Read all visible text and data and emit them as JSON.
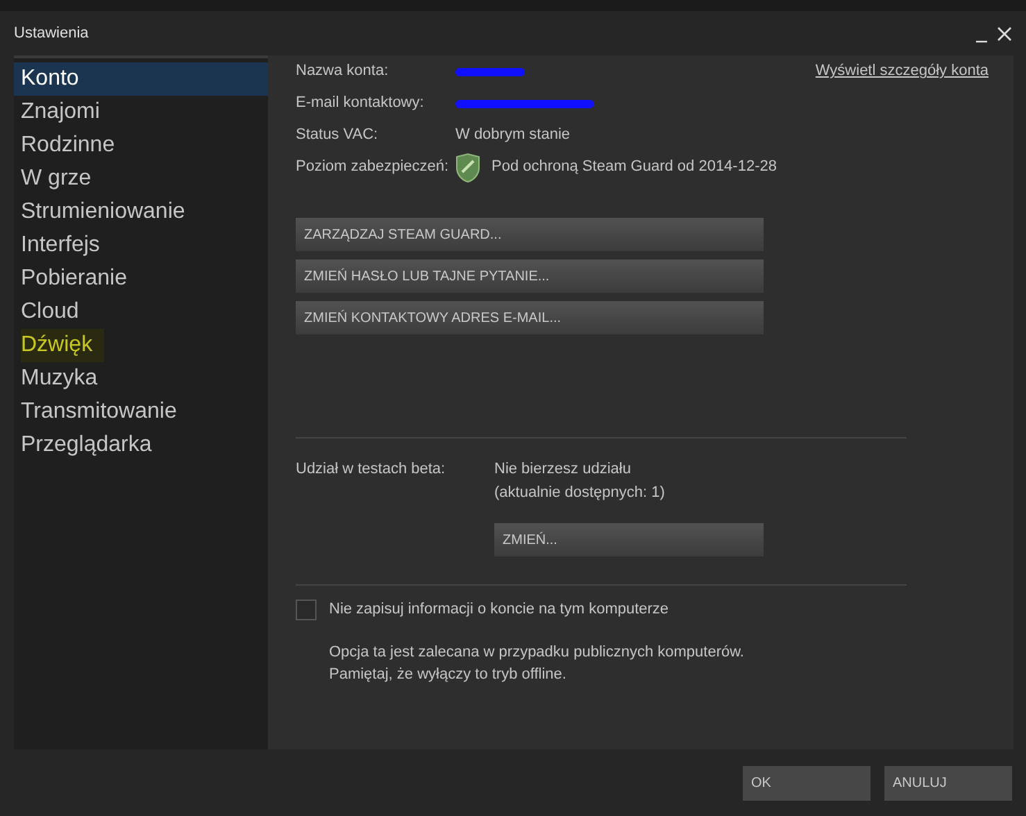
{
  "window": {
    "title": "Ustawienia"
  },
  "sidebar": {
    "items": [
      {
        "label": "Konto",
        "selected": true,
        "highlighted": false
      },
      {
        "label": "Znajomi",
        "selected": false,
        "highlighted": false
      },
      {
        "label": "Rodzinne",
        "selected": false,
        "highlighted": false
      },
      {
        "label": "W grze",
        "selected": false,
        "highlighted": false
      },
      {
        "label": "Strumieniowanie",
        "selected": false,
        "highlighted": false
      },
      {
        "label": "Interfejs",
        "selected": false,
        "highlighted": false
      },
      {
        "label": "Pobieranie",
        "selected": false,
        "highlighted": false
      },
      {
        "label": "Cloud",
        "selected": false,
        "highlighted": false
      },
      {
        "label": "Dźwięk",
        "selected": false,
        "highlighted": true
      },
      {
        "label": "Muzyka",
        "selected": false,
        "highlighted": false
      },
      {
        "label": "Transmitowanie",
        "selected": false,
        "highlighted": false
      },
      {
        "label": "Przeglądarka",
        "selected": false,
        "highlighted": false
      }
    ]
  },
  "account": {
    "details_link": "Wyświetl szczegóły konta",
    "fields": [
      {
        "label": "Nazwa konta:",
        "kind": "redacted"
      },
      {
        "label": "E-mail kontaktowy:",
        "kind": "redacted"
      },
      {
        "label": "Status VAC:",
        "kind": "text",
        "value": "W dobrym stanie"
      },
      {
        "label": "Poziom zabezpieczeń:",
        "kind": "shield",
        "value": "Pod ochroną Steam Guard od 2014-12-28"
      }
    ],
    "buttons": [
      "ZARZĄDZAJ STEAM GUARD...",
      "ZMIEŃ HASŁO LUB TAJNE PYTANIE...",
      "ZMIEŃ KONTAKTOWY ADRES E-MAIL..."
    ]
  },
  "beta": {
    "label": "Udział w testach beta:",
    "status": "Nie bierzesz udziału",
    "available": "(aktualnie dostępnych: 1)",
    "button": "ZMIEŃ..."
  },
  "remember": {
    "label": "Nie zapisuj informacji o koncie na tym komputerze",
    "checked": false,
    "note_lines": [
      "Opcja ta jest zalecana w przypadku publicznych komputerów.",
      "Pamiętaj, że wyłączy to tryb offline."
    ]
  },
  "footer": {
    "buttons": [
      "OK",
      "ANULUJ"
    ]
  }
}
